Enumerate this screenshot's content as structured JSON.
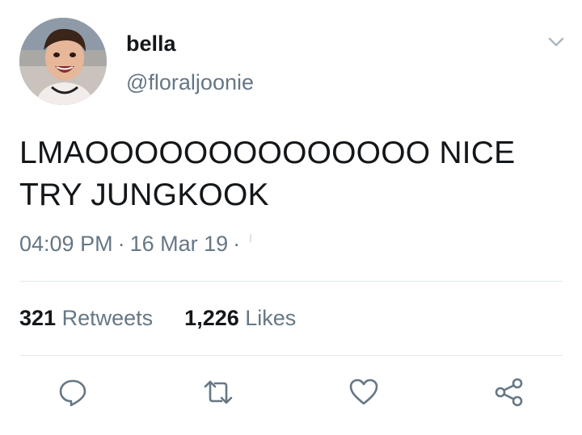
{
  "user": {
    "display_name": "bella",
    "handle": "@floraljoonie"
  },
  "tweet": {
    "text_lines": [
      "LMAOOOOOOOOOOOOOO NICE",
      "TRY JUNGKOOK"
    ],
    "time": "04:09 PM",
    "separator": "·",
    "date": "16 Mar 19",
    "trailing_separator": "·"
  },
  "stats": {
    "retweets_count": "321",
    "retweets_label": "Retweets",
    "likes_count": "1,226",
    "likes_label": "Likes"
  },
  "icons": {
    "caret": "chevron-down-icon",
    "reply": "reply-icon",
    "retweet": "retweet-icon",
    "like": "heart-icon",
    "share": "share-icon"
  },
  "colors": {
    "text": "#14171a",
    "secondary": "#657786",
    "divider": "#e1e8ed",
    "caret": "#aab8c2"
  }
}
